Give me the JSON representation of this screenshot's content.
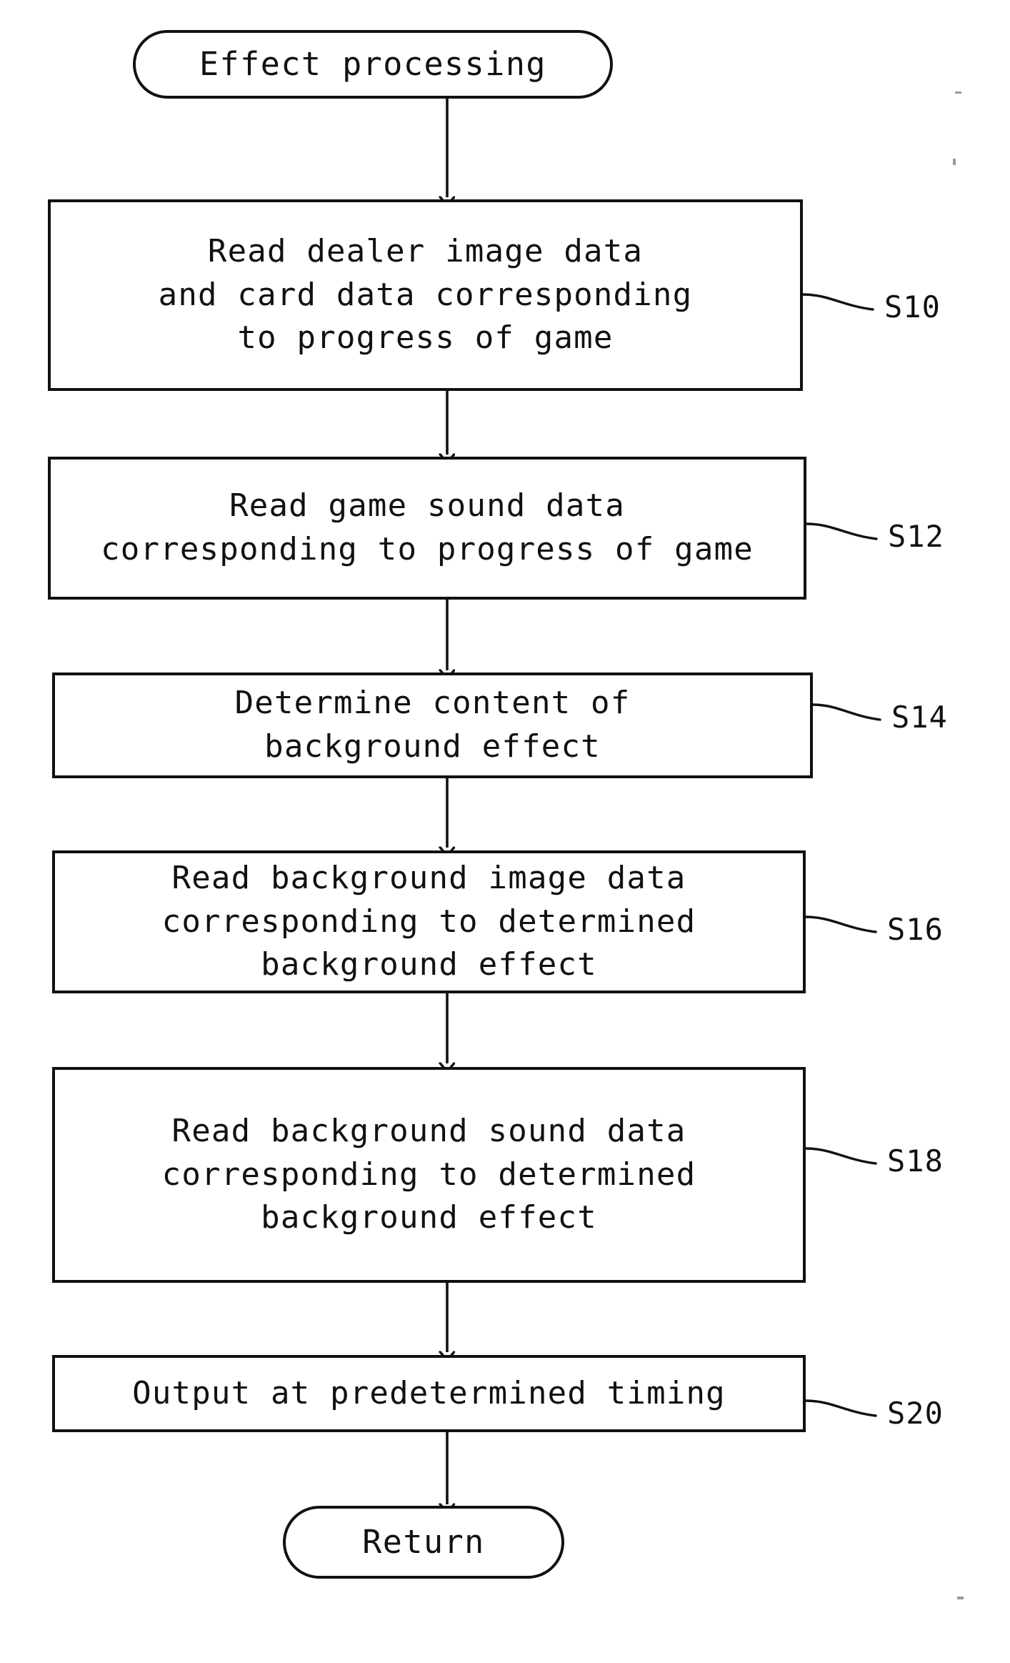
{
  "diagram": {
    "type": "flowchart",
    "title_node": "Effect processing",
    "end_node": "Return",
    "ink_color": "#111111",
    "paper_color": "#ffffff",
    "start": {
      "label": "Effect processing"
    },
    "end": {
      "label": "Return"
    },
    "steps": [
      {
        "id": "S10",
        "ref": "S10",
        "lines": [
          "Read dealer image data",
          "and card data corresponding",
          "to progress of game"
        ]
      },
      {
        "id": "S12",
        "ref": "S12",
        "lines": [
          "Read game sound data",
          "corresponding to progress of game"
        ]
      },
      {
        "id": "S14",
        "ref": "S14",
        "lines": [
          "Determine content of",
          "background effect"
        ]
      },
      {
        "id": "S16",
        "ref": "S16",
        "lines": [
          "Read background image data",
          "corresponding to determined",
          "background effect"
        ]
      },
      {
        "id": "S18",
        "ref": "S18",
        "lines": [
          "Read background sound data",
          "corresponding to determined",
          "background effect"
        ]
      },
      {
        "id": "S20",
        "ref": "S20",
        "lines": [
          "Output at predetermined timing"
        ]
      }
    ]
  }
}
